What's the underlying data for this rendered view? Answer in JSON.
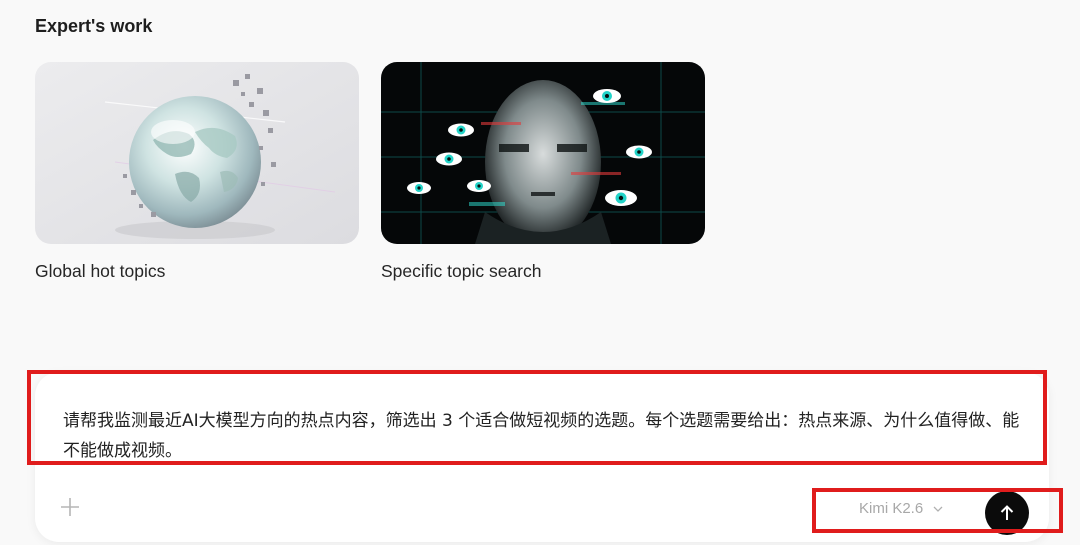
{
  "section": {
    "title": "Expert's work"
  },
  "cards": [
    {
      "label": "Global hot topics",
      "image_icon": "glass-globe-image"
    },
    {
      "label": "Specific topic search",
      "image_icon": "glitch-face-eyes-image"
    }
  ],
  "composer": {
    "prompt": "请帮我监测最近AI大模型方向的热点内容，筛选出 3 个适合做短视频的选题。每个选题需要给出：热点来源、为什么值得做、能不能做成视频。",
    "add_icon": "plus-icon",
    "model_label": "Kimi K2.6",
    "model_icon": "chevron-down-icon",
    "send_icon": "arrow-up-icon"
  },
  "colors": {
    "background": "#f9f9f9",
    "send_button": "#0b0b0b",
    "annotation": "#e01c1c",
    "model_text": "#a8a8a8"
  }
}
